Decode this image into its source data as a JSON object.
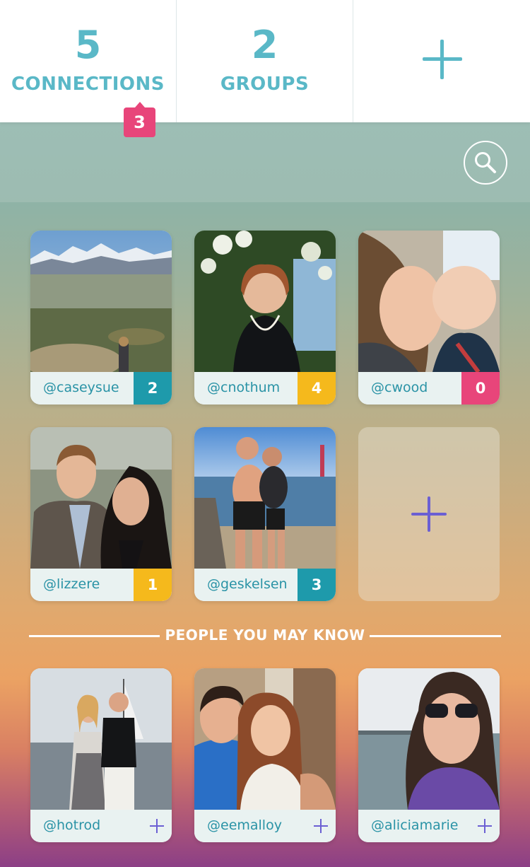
{
  "stats": {
    "connections": {
      "count": "5",
      "label": "CONNECTIONS",
      "badge": "3"
    },
    "groups": {
      "count": "2",
      "label": "GROUPS"
    }
  },
  "colors": {
    "accent": "#5ab8c7",
    "badge_pink": "#e8457a",
    "count_teal": "#1e9aab",
    "count_yellow": "#f5b91c",
    "count_pink": "#e8457a",
    "add_purple": "#6b5fd3"
  },
  "connections": [
    {
      "handle": "@caseysue",
      "count": "2",
      "count_color": "teal"
    },
    {
      "handle": "@cnothum",
      "count": "4",
      "count_color": "yellow"
    },
    {
      "handle": "@cwood",
      "count": "0",
      "count_color": "pink"
    },
    {
      "handle": "@lizzere",
      "count": "1",
      "count_color": "yellow"
    },
    {
      "handle": "@geskelsen",
      "count": "3",
      "count_color": "teal"
    }
  ],
  "suggestions_title": "PEOPLE YOU MAY KNOW",
  "suggestions": [
    {
      "handle": "@hotrod"
    },
    {
      "handle": "@eemalloy"
    },
    {
      "handle": "@aliciamarie"
    }
  ],
  "icons": {
    "add_stat": "plus-icon",
    "search": "search-icon",
    "add_connection": "plus-icon",
    "add_suggestion": "plus-icon"
  }
}
